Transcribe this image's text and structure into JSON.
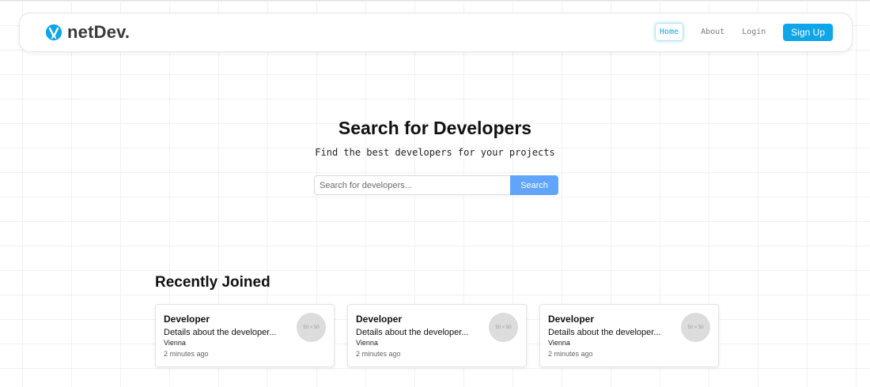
{
  "header": {
    "brand": "netDev.",
    "nav": [
      {
        "label": "Home",
        "active": true
      },
      {
        "label": "About",
        "active": false
      },
      {
        "label": "Login",
        "active": false
      }
    ],
    "signup_label": "Sign Up"
  },
  "hero": {
    "title": "Search for Developers",
    "subtitle": "Find the best developers for your projects",
    "search_placeholder": "Search for developers...",
    "search_button": "Search"
  },
  "recent": {
    "title": "Recently Joined",
    "cards": [
      {
        "title": "Developer",
        "description": "Details about the developer...",
        "location": "Vienna",
        "time": "2 minutes ago",
        "avatar_label": "50 × 50"
      },
      {
        "title": "Developer",
        "description": "Details about the developer...",
        "location": "Vienna",
        "time": "2 minutes ago",
        "avatar_label": "50 × 50"
      },
      {
        "title": "Developer",
        "description": "Details about the developer...",
        "location": "Vienna",
        "time": "2 minutes ago",
        "avatar_label": "50 × 50"
      }
    ]
  },
  "colors": {
    "accent": "#0ea5e9",
    "search_button": "#60a5fa",
    "logo": "#0ea5e9"
  },
  "icons": {
    "logo": "netdev-logo-icon"
  }
}
